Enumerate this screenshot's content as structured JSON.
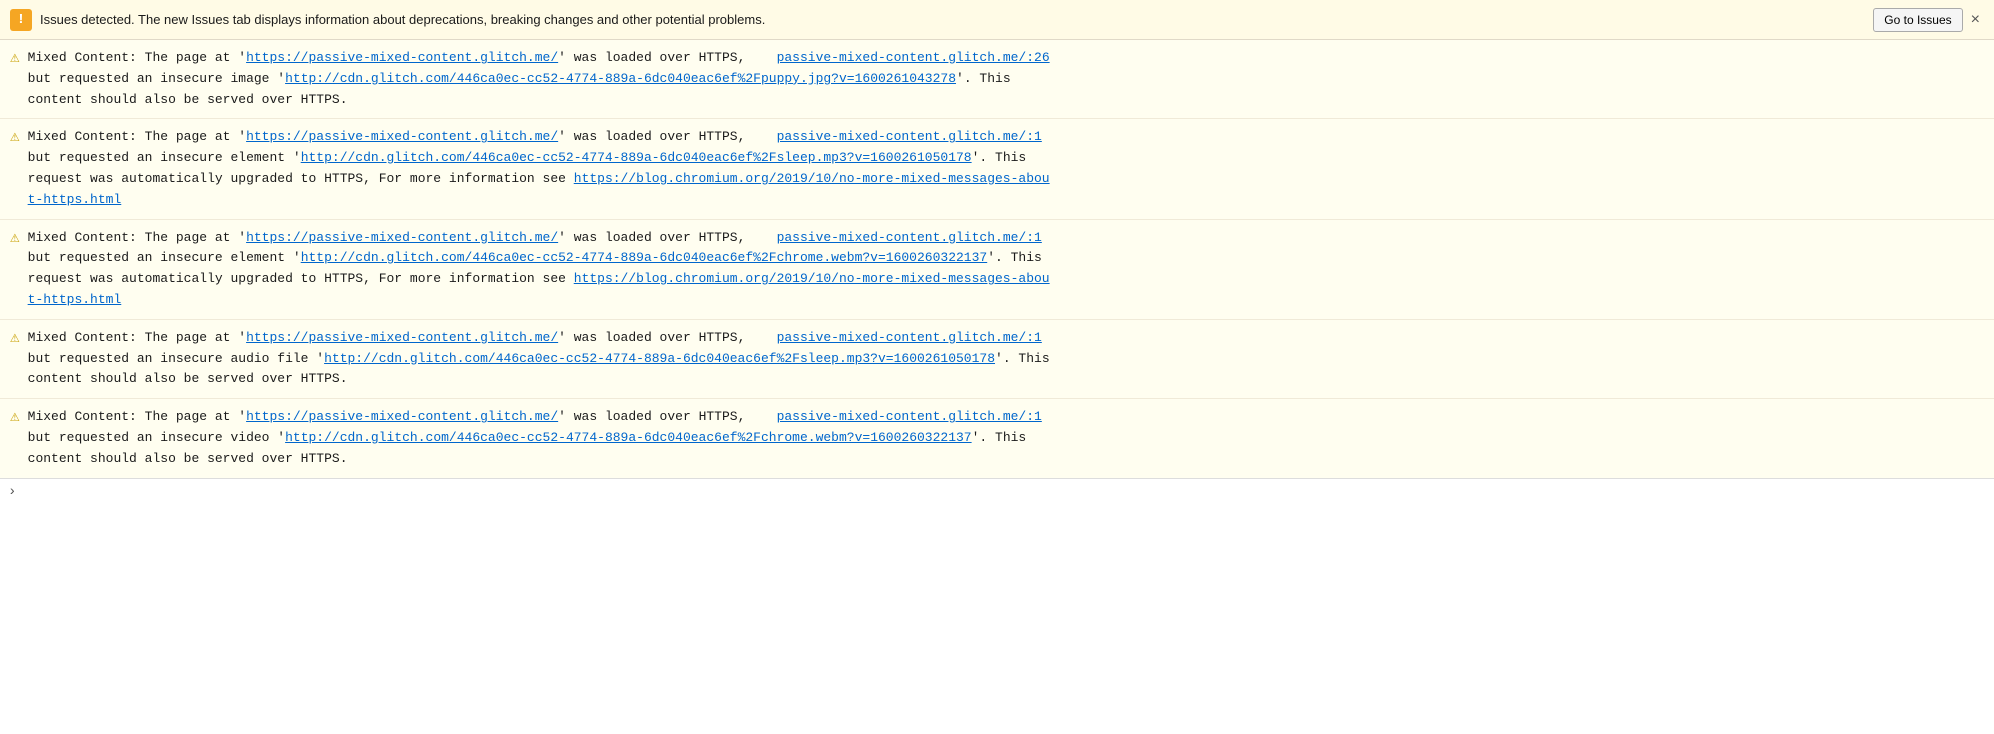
{
  "issuesBar": {
    "icon": "!",
    "text": "Issues detected. The new Issues tab displays information about deprecations, breaking changes and other potential problems.",
    "goToIssuesLabel": "Go to Issues",
    "closeLabel": "×"
  },
  "messages": [
    {
      "id": 1,
      "text_before_link1": "Mixed Content: The page at '",
      "link1_text": "https://passive-mixed-content.glitch.me/",
      "link1_href": "https://passive-mixed-content.glitch.me/",
      "text_after_link1": "' was loaded over HTTPS,",
      "link2_text": "passive-mixed-content.glitch.me/:26",
      "link2_href": "passive-mixed-content.glitch.me/:26",
      "line2_before": "but requested an insecure image '",
      "line2_link_text": "http://cdn.glitch.com/446ca0ec-cc52-4774-889a-6dc040eac6ef%2Fpuppy.jpg?v=1600261043278",
      "line2_link_href": "http://cdn.glitch.com/446ca0ec-cc52-4774-889a-6dc040eac6ef%2Fpuppy.jpg?v=1600261043278",
      "line2_after": "'. This",
      "line3": "content should also be served over HTTPS."
    },
    {
      "id": 2,
      "text_before_link1": "Mixed Content: The page at '",
      "link1_text": "https://passive-mixed-content.glitch.me/",
      "link1_href": "https://passive-mixed-content.glitch.me/",
      "text_after_link1": "' was loaded over HTTPS,",
      "link2_text": "passive-mixed-content.glitch.me/:1",
      "link2_href": "passive-mixed-content.glitch.me/:1",
      "line2_before": "but requested an insecure element '",
      "line2_link_text": "http://cdn.glitch.com/446ca0ec-cc52-4774-889a-6dc040eac6ef%2Fsleep.mp3?v=1600261050178",
      "line2_link_href": "http://cdn.glitch.com/446ca0ec-cc52-4774-889a-6dc040eac6ef%2Fsleep.mp3?v=1600261050178",
      "line2_after": "'. This",
      "line3_before": "request was automatically upgraded to HTTPS, For more information see ",
      "line3_link_text": "https://blog.chromium.org/2019/10/no-more-mixed-messages-about-https.html",
      "line3_link_href": "https://blog.chromium.org/2019/10/no-more-mixed-messages-about-https.html",
      "has_blog_link": true
    },
    {
      "id": 3,
      "text_before_link1": "Mixed Content: The page at '",
      "link1_text": "https://passive-mixed-content.glitch.me/",
      "link1_href": "https://passive-mixed-content.glitch.me/",
      "text_after_link1": "' was loaded over HTTPS,",
      "link2_text": "passive-mixed-content.glitch.me/:1",
      "link2_href": "passive-mixed-content.glitch.me/:1",
      "line2_before": "but requested an insecure element '",
      "line2_link_text": "http://cdn.glitch.com/446ca0ec-cc52-4774-889a-6dc040eac6ef%2Fchrome.webm?v=1600260322137",
      "line2_link_href": "http://cdn.glitch.com/446ca0ec-cc52-4774-889a-6dc040eac6ef%2Fchrome.webm?v=1600260322137",
      "line2_after": "'. This",
      "line3_before": "request was automatically upgraded to HTTPS, For more information see ",
      "line3_link_text": "https://blog.chromium.org/2019/10/no-more-mixed-messages-about-https.html",
      "line3_link_href": "https://blog.chromium.org/2019/10/no-more-mixed-messages-about-https.html",
      "has_blog_link": true
    },
    {
      "id": 4,
      "text_before_link1": "Mixed Content: The page at '",
      "link1_text": "https://passive-mixed-content.glitch.me/",
      "link1_href": "https://passive-mixed-content.glitch.me/",
      "text_after_link1": "' was loaded over HTTPS,",
      "link2_text": "passive-mixed-content.glitch.me/:1",
      "link2_href": "passive-mixed-content.glitch.me/:1",
      "line2_before": "but requested an insecure audio file '",
      "line2_link_text": "http://cdn.glitch.com/446ca0ec-cc52-4774-889a-6dc040eac6ef%2Fsleep.mp3?v=1600261050178",
      "line2_link_href": "http://cdn.glitch.com/446ca0ec-cc52-4774-889a-6dc040eac6ef%2Fsleep.mp3?v=1600261050178",
      "line2_after": "'. This",
      "line3": "content should also be served over HTTPS."
    },
    {
      "id": 5,
      "text_before_link1": "Mixed Content: The page at '",
      "link1_text": "https://passive-mixed-content.glitch.me/",
      "link1_href": "https://passive-mixed-content.glitch.me/",
      "text_after_link1": "' was loaded over HTTPS,",
      "link2_text": "passive-mixed-content.glitch.me/:1",
      "link2_href": "passive-mixed-content.glitch.me/:1",
      "line2_before": "but requested an insecure video '",
      "line2_link_text": "http://cdn.glitch.com/446ca0ec-cc52-4774-889a-6dc040eac6ef%2Fchrome.webm?v=1600260322137",
      "line2_link_href": "http://cdn.glitch.com/446ca0ec-cc52-4774-889a-6dc040eac6ef%2Fchrome.webm?v=1600260322137",
      "line2_after": "'. This",
      "line3": "content should also be served over HTTPS."
    }
  ],
  "bottomBar": {
    "chevron": "›"
  }
}
